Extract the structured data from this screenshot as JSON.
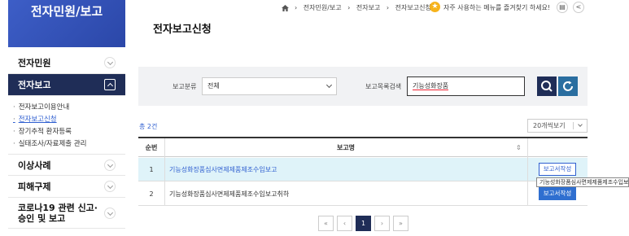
{
  "sidebar": {
    "title": "전자민원/보고",
    "items": [
      {
        "label": "전자민원"
      },
      {
        "label": "전자보고"
      },
      {
        "label": "이상사례"
      },
      {
        "label": "피해구제"
      },
      {
        "label": "코로나19 관련 신고·승인 및 보고"
      }
    ],
    "subitems": [
      {
        "label": "전자보고이용안내"
      },
      {
        "label": "전자보고신청"
      },
      {
        "label": "장기추적 환자등록"
      },
      {
        "label": "실태조사/자료제출 관리"
      }
    ]
  },
  "topbar": {
    "crumbs": [
      "전자민원/보고",
      "전자보고",
      "전자보고신청"
    ],
    "favorite_text": "자주 사용하는 메뉴를 즐겨찾기 하세요!"
  },
  "page_title": "전자보고신청",
  "search": {
    "category_label": "보고분류",
    "category_value": "전체",
    "keyword_label": "보고목록검색",
    "keyword_value": "기능성화장품"
  },
  "list": {
    "total": "총 2건",
    "per_page": "20개씩보기",
    "headers": {
      "no": "순번",
      "name": "보고명"
    },
    "rows": [
      {
        "no": "1",
        "name": "기능성화장품심사면제제품제조수입보고",
        "action": "보고서작성"
      },
      {
        "no": "2",
        "name": "기능성화장품심사면제제품제조수입보고취하",
        "action": "보고서작성"
      }
    ],
    "tooltip": "기능성화장품심사면제제품제조수입보고"
  },
  "pagination": {
    "first": "«",
    "prev": "‹",
    "current": "1",
    "next": "›",
    "last": "»"
  },
  "colors": {
    "navy": "#1f2d57",
    "blue": "#2f5fd0",
    "highlight": "#dff3f9"
  }
}
